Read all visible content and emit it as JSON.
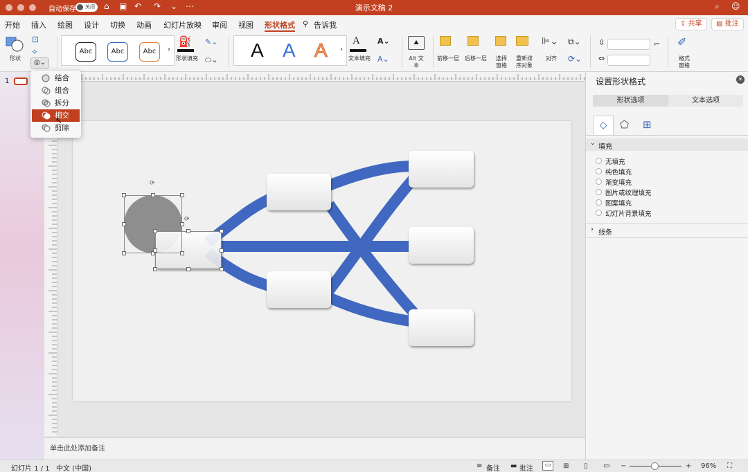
{
  "titlebar": {
    "autosave_label": "自动保存",
    "autosave_toggle": "关闭",
    "doc_title": "演示文稿 2"
  },
  "menu": {
    "items": [
      "开始",
      "插入",
      "绘图",
      "设计",
      "切换",
      "动画",
      "幻灯片放映",
      "审阅",
      "视图",
      "形状格式"
    ],
    "tell_me": "告诉我",
    "share": "共享",
    "comments": "批注"
  },
  "ribbon": {
    "shapes_label": "形状",
    "shape_styles": [
      "Abc",
      "Abc",
      "Abc"
    ],
    "shape_fill_label": "形状填充",
    "wordart_letters": [
      "A",
      "A",
      "A"
    ],
    "text_fill_label": "文本填充",
    "alt_text_label": "Alt 文本",
    "bring_forward_label": "前移一层",
    "send_backward_label": "后移一层",
    "selection_pane_label": "选择窗格",
    "reorder_label": "重新排序对象",
    "align_label": "对齐",
    "format_pane_label": "格式窗格"
  },
  "merge_menu": {
    "items": [
      "结合",
      "组合",
      "拆分",
      "相交",
      "剪除"
    ],
    "selected": "相交"
  },
  "thumbnails": {
    "slide_number": "1"
  },
  "notes": {
    "placeholder": "单击此处添加备注"
  },
  "format_pane": {
    "title": "设置形状格式",
    "tabs": [
      "形状选项",
      "文本选项"
    ],
    "fill_section": "填充",
    "fill_options": [
      "无填充",
      "纯色填充",
      "渐变填充",
      "图片或纹理填充",
      "图案填充",
      "幻灯片背景填充"
    ],
    "line_section": "线条"
  },
  "statusbar": {
    "slide_info": "幻灯片 1 / 1",
    "language": "中文 (中国)",
    "notes": "备注",
    "comments": "批注",
    "zoom": "96%"
  },
  "colors": {
    "accent": "#c2401f",
    "connector_blue": "#4168c0",
    "shape_gray": "#8e8e8e"
  }
}
